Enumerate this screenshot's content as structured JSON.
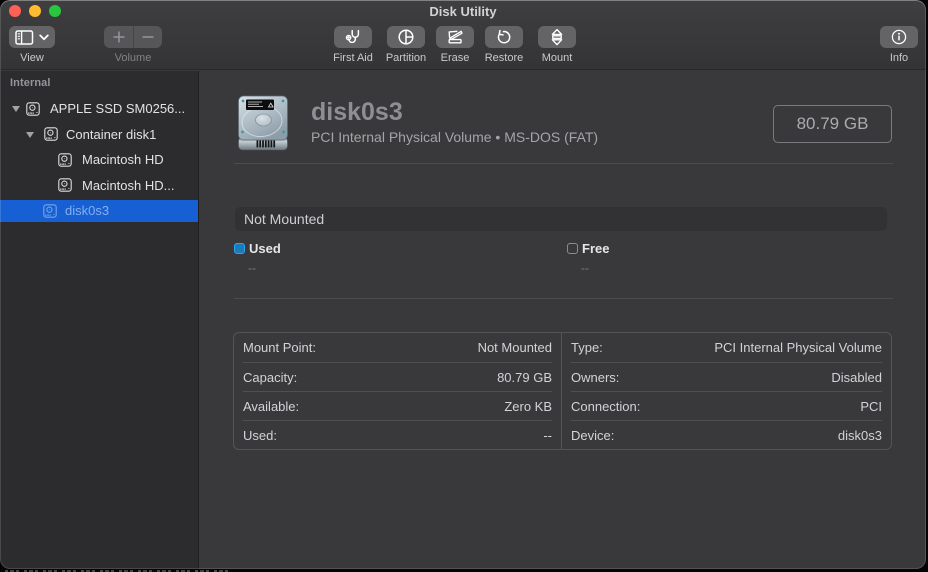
{
  "window": {
    "title": "Disk Utility"
  },
  "toolbar": {
    "view": {
      "label": "View"
    },
    "volume": {
      "label": "Volume"
    },
    "actions": [
      {
        "label": "First Aid"
      },
      {
        "label": "Partition"
      },
      {
        "label": "Erase"
      },
      {
        "label": "Restore"
      },
      {
        "label": "Mount"
      }
    ],
    "info": {
      "label": "Info"
    }
  },
  "sidebar": {
    "section": "Internal",
    "items": [
      {
        "label": "APPLE SSD SM0256...",
        "level": 0,
        "expanded": true,
        "selected": false
      },
      {
        "label": "Container disk1",
        "level": 1,
        "expanded": true,
        "selected": false
      },
      {
        "label": "Macintosh HD",
        "level": 2,
        "selected": false
      },
      {
        "label": "Macintosh HD...",
        "level": 2,
        "selected": false
      },
      {
        "label": "disk0s3",
        "level": 1,
        "selected": true
      }
    ]
  },
  "main": {
    "title": "disk0s3",
    "subtitle": "PCI Internal Physical Volume • MS-DOS (FAT)",
    "size_badge": "80.79 GB",
    "mount_status": "Not Mounted",
    "legend": [
      {
        "label": "Used",
        "value": "--"
      },
      {
        "label": "Free",
        "value": "--"
      }
    ],
    "details": {
      "left": [
        {
          "label": "Mount Point:",
          "value": "Not Mounted"
        },
        {
          "label": "Capacity:",
          "value": "80.79 GB"
        },
        {
          "label": "Available:",
          "value": "Zero KB"
        },
        {
          "label": "Used:",
          "value": "--"
        }
      ],
      "right": [
        {
          "label": "Type:",
          "value": "PCI Internal Physical Volume"
        },
        {
          "label": "Owners:",
          "value": "Disabled"
        },
        {
          "label": "Connection:",
          "value": "PCI"
        },
        {
          "label": "Device:",
          "value": "disk0s3"
        }
      ]
    }
  },
  "colors": {
    "selection_blue": "#1660d4",
    "used_swatch_border": "#27a6ef",
    "used_swatch_fill": "#1b7cba",
    "traffic_red": "#fe5f57",
    "traffic_yellow": "#febc2e",
    "traffic_green": "#27c83f"
  }
}
